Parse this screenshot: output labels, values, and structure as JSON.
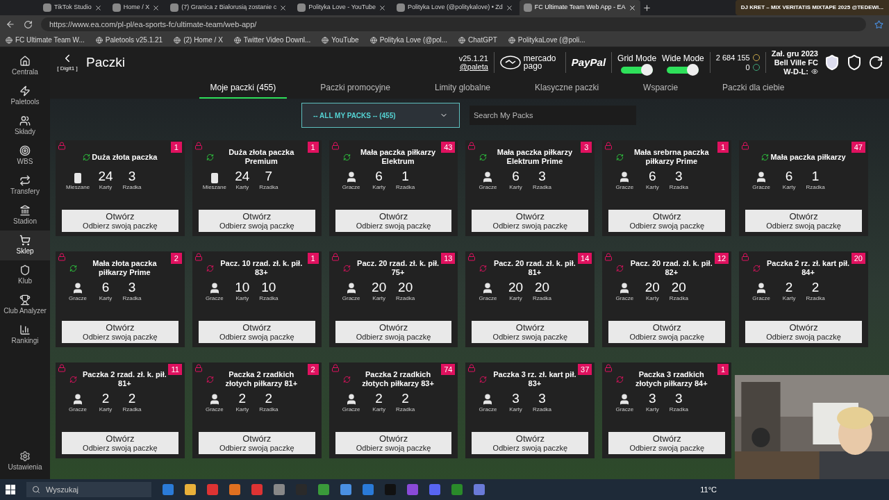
{
  "browser": {
    "tabs": [
      {
        "title": "TikTok Studio",
        "selected": false
      },
      {
        "title": "Home / X",
        "selected": false
      },
      {
        "title": "(7) Granica z Białorusią zostanie c",
        "selected": false
      },
      {
        "title": "Polityka Love - YouTube",
        "selected": false
      },
      {
        "title": "Polityka Love (@politykalove) • Zd",
        "selected": false
      },
      {
        "title": "FC Ultimate Team Web App - EA",
        "selected": true
      }
    ],
    "now_playing": "DJ KRET – MIX VERITATIS MIXTAPE 2025 @TEDEWI...",
    "url": "https://www.ea.com/pl-pl/ea-sports-fc/ultimate-team/web-app/",
    "bookmarks": [
      "FC Ultimate Team W...",
      "Paletools v25.1.21",
      "(2) Home / X",
      "Twitter Video Downl...",
      "YouTube",
      "Polityka Love (@pol...",
      "ChatGPT",
      "PolitykaLove (@poli..."
    ]
  },
  "sidebar": {
    "items": [
      {
        "label": "Centrala",
        "selected": false
      },
      {
        "label": "Paletools",
        "selected": false
      },
      {
        "label": "Składy",
        "selected": false
      },
      {
        "label": "WBS",
        "selected": false
      },
      {
        "label": "Transfery",
        "selected": false
      },
      {
        "label": "Stadion",
        "selected": false
      },
      {
        "label": "Sklep",
        "selected": true
      },
      {
        "label": "Klub",
        "selected": false
      },
      {
        "label": "Club Analyzer",
        "selected": false
      },
      {
        "label": "Rankingi",
        "selected": false
      }
    ],
    "settings": "Ustawienia"
  },
  "header": {
    "back_hint": "[ Digit1 ]",
    "title": "Paczki",
    "version": "v25.1.21",
    "author": "@paleta",
    "mercado": "mercado pago",
    "paypal": "PayPal",
    "toggles": [
      {
        "label": "Grid Mode",
        "on": true
      },
      {
        "label": "Wide Mode",
        "on": true
      }
    ],
    "coins": "2 684 155",
    "points": "0",
    "club_since": "Zał. gru 2023",
    "club_name": "Bell Ville FC",
    "wdl": "W-D-L:"
  },
  "nav_tabs": [
    {
      "label": "Moje paczki (455)",
      "selected": true
    },
    {
      "label": "Paczki promocyjne",
      "selected": false
    },
    {
      "label": "Limity globalne",
      "selected": false
    },
    {
      "label": "Klasyczne paczki",
      "selected": false
    },
    {
      "label": "Wsparcie",
      "selected": false
    },
    {
      "label": "Paczki dla ciebie",
      "selected": false
    }
  ],
  "filter": {
    "value": "-- ALL MY PACKS -- (455)",
    "search_placeholder": "Search My Packs"
  },
  "packs": [
    {
      "title": "Duża złota paczka",
      "count": "1",
      "kind": "mixed",
      "tradeable": true,
      "type_label": "Mieszane",
      "cards": "24",
      "cards_label": "Karty",
      "rarity": "3",
      "rarity_label": "Rzadka",
      "open": "Otwórz",
      "open_sub": "Odbierz swoją paczkę"
    },
    {
      "title": "Duża złota paczka Premium",
      "count": "1",
      "kind": "mixed",
      "tradeable": true,
      "type_label": "Mieszane",
      "cards": "24",
      "cards_label": "Karty",
      "rarity": "7",
      "rarity_label": "Rzadka",
      "open": "Otwórz",
      "open_sub": "Odbierz swoją paczkę"
    },
    {
      "title": "Mała paczka piłkarzy Elektrum",
      "count": "43",
      "kind": "players",
      "tradeable": true,
      "type_label": "Gracze",
      "cards": "6",
      "cards_label": "Karty",
      "rarity": "1",
      "rarity_label": "Rzadka",
      "open": "Otwórz",
      "open_sub": "Odbierz swoją paczkę"
    },
    {
      "title": "Mała paczka piłkarzy Elektrum Prime",
      "count": "3",
      "kind": "players",
      "tradeable": true,
      "type_label": "Gracze",
      "cards": "6",
      "cards_label": "Karty",
      "rarity": "3",
      "rarity_label": "Rzadka",
      "open": "Otwórz",
      "open_sub": "Odbierz swoją paczkę"
    },
    {
      "title": "Mała srebrna paczka piłkarzy Prime",
      "count": "1",
      "kind": "players",
      "tradeable": true,
      "type_label": "Gracze",
      "cards": "6",
      "cards_label": "Karty",
      "rarity": "3",
      "rarity_label": "Rzadka",
      "open": "Otwórz",
      "open_sub": "Odbierz swoją paczkę"
    },
    {
      "title": "Mała paczka piłkarzy",
      "count": "47",
      "kind": "players",
      "tradeable": true,
      "type_label": "Gracze",
      "cards": "6",
      "cards_label": "Karty",
      "rarity": "1",
      "rarity_label": "Rzadka",
      "open": "Otwórz",
      "open_sub": "Odbierz swoją paczkę"
    },
    {
      "title": "Mała złota paczka piłkarzy Prime",
      "count": "2",
      "kind": "players",
      "tradeable": true,
      "type_label": "Gracze",
      "cards": "6",
      "cards_label": "Karty",
      "rarity": "3",
      "rarity_label": "Rzadka",
      "open": "Otwórz",
      "open_sub": "Odbierz swoją paczkę"
    },
    {
      "title": "Pacz. 10 rzad. zł. k. pił. 83+",
      "count": "1",
      "kind": "players",
      "tradeable": false,
      "type_label": "Gracze",
      "cards": "10",
      "cards_label": "Karty",
      "rarity": "10",
      "rarity_label": "Rzadka",
      "open": "Otwórz",
      "open_sub": "Odbierz swoją paczkę"
    },
    {
      "title": "Pacz. 20 rzad. zł. k. pił. 75+",
      "count": "13",
      "kind": "players",
      "tradeable": false,
      "type_label": "Gracze",
      "cards": "20",
      "cards_label": "Karty",
      "rarity": "20",
      "rarity_label": "Rzadka",
      "open": "Otwórz",
      "open_sub": "Odbierz swoją paczkę"
    },
    {
      "title": "Pacz. 20 rzad. zł. k. pił. 81+",
      "count": "14",
      "kind": "players",
      "tradeable": false,
      "type_label": "Gracze",
      "cards": "20",
      "cards_label": "Karty",
      "rarity": "20",
      "rarity_label": "Rzadka",
      "open": "Otwórz",
      "open_sub": "Odbierz swoją paczkę"
    },
    {
      "title": "Pacz. 20 rzad. zł. k. pił. 82+",
      "count": "12",
      "kind": "players",
      "tradeable": false,
      "type_label": "Gracze",
      "cards": "20",
      "cards_label": "Karty",
      "rarity": "20",
      "rarity_label": "Rzadka",
      "open": "Otwórz",
      "open_sub": "Odbierz swoją paczkę"
    },
    {
      "title": "Paczka 2 rz. zł. kart pił. 84+",
      "count": "20",
      "kind": "players",
      "tradeable": false,
      "type_label": "Gracze",
      "cards": "2",
      "cards_label": "Karty",
      "rarity": "2",
      "rarity_label": "Rzadka",
      "open": "Otwórz",
      "open_sub": "Odbierz swoją paczkę"
    },
    {
      "title": "Paczka 2 rzad. zł. k. pił. 81+",
      "count": "11",
      "kind": "players",
      "tradeable": false,
      "type_label": "Gracze",
      "cards": "2",
      "cards_label": "Karty",
      "rarity": "2",
      "rarity_label": "Rzadka",
      "open": "Otwórz",
      "open_sub": "Odbierz swoją paczkę"
    },
    {
      "title": "Paczka 2 rzadkich złotych piłkarzy 81+",
      "count": "2",
      "kind": "players",
      "tradeable": false,
      "type_label": "Gracze",
      "cards": "2",
      "cards_label": "Karty",
      "rarity": "2",
      "rarity_label": "Rzadka",
      "open": "Otwórz",
      "open_sub": "Odbierz swoją paczkę"
    },
    {
      "title": "Paczka 2 rzadkich złotych piłkarzy 83+",
      "count": "74",
      "kind": "players",
      "tradeable": false,
      "type_label": "Gracze",
      "cards": "2",
      "cards_label": "Karty",
      "rarity": "2",
      "rarity_label": "Rzadka",
      "open": "Otwórz",
      "open_sub": "Odbierz swoją paczkę"
    },
    {
      "title": "Paczka 3 rz. zł. kart pił. 83+",
      "count": "37",
      "kind": "players",
      "tradeable": false,
      "type_label": "Gracze",
      "cards": "3",
      "cards_label": "Karty",
      "rarity": "3",
      "rarity_label": "Rzadka",
      "open": "Otwórz",
      "open_sub": "Odbierz swoją paczkę"
    },
    {
      "title": "Paczka 3 rzadkich złotych piłkarzy 84+",
      "count": "1",
      "kind": "players",
      "tradeable": false,
      "type_label": "Gracze",
      "cards": "3",
      "cards_label": "Karty",
      "rarity": "3",
      "rarity_label": "Rzadka",
      "open": "Otwórz",
      "open_sub": "Odbierz swoją paczkę"
    }
  ],
  "taskbar": {
    "search": "Wyszukaj",
    "weather": "11°C"
  }
}
